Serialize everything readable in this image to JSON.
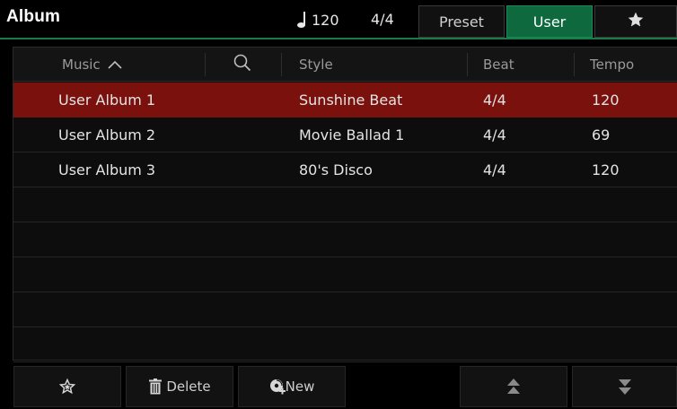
{
  "header": {
    "title": "Album",
    "tempo": "120",
    "beat": "4/4",
    "tabs": [
      {
        "label": "Preset",
        "active": false
      },
      {
        "label": "User",
        "active": true
      }
    ],
    "favorite_tab_icon": "star-icon"
  },
  "table": {
    "columns": {
      "music": "Music",
      "style": "Style",
      "beat": "Beat",
      "tempo": "Tempo"
    },
    "sort_icon": "chevron-up-icon",
    "search_icon": "search-icon",
    "rows": [
      {
        "music": "User Album 1",
        "style": "Sunshine Beat",
        "beat": "4/4",
        "tempo": "120",
        "selected": true
      },
      {
        "music": "User Album 2",
        "style": "Movie Ballad 1",
        "beat": "4/4",
        "tempo": "69",
        "selected": false
      },
      {
        "music": "User Album 3",
        "style": "80's Disco",
        "beat": "4/4",
        "tempo": "120",
        "selected": false
      }
    ]
  },
  "toolbar": {
    "delete_label": "Delete",
    "new_label": "New",
    "icons": [
      "star-outline-icon",
      "trash-icon",
      "new-icon",
      "page-up-icon",
      "page-down-icon"
    ]
  },
  "colors": {
    "accent_green": "#0e6a3e",
    "selected_row": "#7a110d",
    "background": "#000000"
  }
}
